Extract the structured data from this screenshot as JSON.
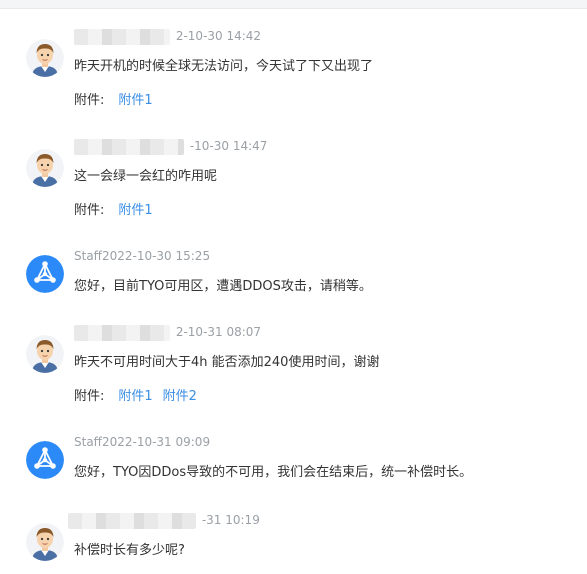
{
  "messages": [
    {
      "kind": "user",
      "time": "2-10-30 14:42",
      "text": "昨天开机的时候全球无法访问，今天试了下又出现了",
      "attachments_label": "附件:",
      "attachments": [
        "附件1"
      ]
    },
    {
      "kind": "user",
      "time": "-10-30 14:47",
      "text": "这一会绿一会红的咋用呢",
      "attachments_label": "附件:",
      "attachments": [
        "附件1"
      ]
    },
    {
      "kind": "staff",
      "time": "Staff2022-10-30 15:25",
      "text": "您好，目前TYO可用区，遭遇DDOS攻击，请稍等。"
    },
    {
      "kind": "user",
      "time": "2-10-31 08:07",
      "text": "昨天不可用时间大于4h 能否添加240使用时间，谢谢",
      "attachments_label": "附件:",
      "attachments": [
        "附件1",
        "附件2"
      ]
    },
    {
      "kind": "staff",
      "time": "Staff2022-10-31 09:09",
      "text": "您好，TYO因DDos导致的不可用，我们会在结束后，统一补偿时长。"
    },
    {
      "kind": "user",
      "time": "-31 10:19",
      "text": "补偿时长有多少呢?"
    }
  ],
  "colors": {
    "link": "#3a8ee6",
    "staff_avatar": "#2b8af7",
    "meta": "#9aa0a6"
  },
  "icons": {
    "user_avatar": "cartoon-man-avatar",
    "staff_avatar": "network-node-logo"
  }
}
